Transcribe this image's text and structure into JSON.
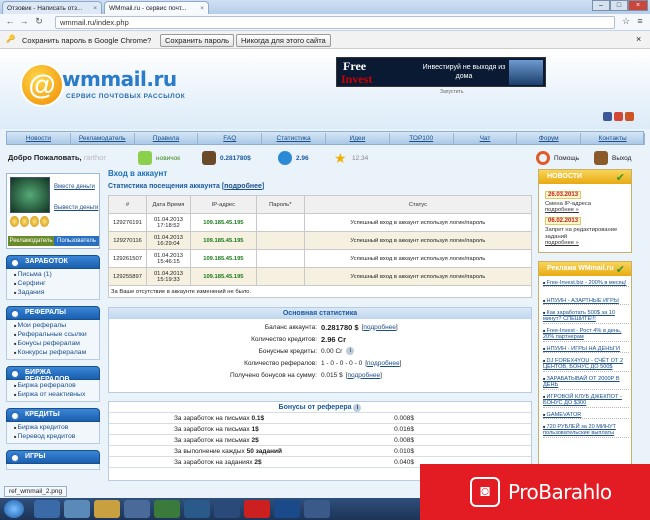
{
  "browser": {
    "tabs": [
      {
        "label": "Отзовик - Написать отз..."
      },
      {
        "label": "WMmail.ru - сервис почт..."
      }
    ],
    "url": "wmmail.ru/index.php",
    "password_bar": {
      "text": "Сохранить пароль в Google Chrome?",
      "save_label": "Сохранить пароль",
      "never_label": "Никогда для этого сайта"
    }
  },
  "site": {
    "logo_text": "wmmail.ru",
    "logo_sub": "СЕРВИС ПОЧТОВЫХ РАССЫЛОК",
    "ad": {
      "free": "Free",
      "invest": "Invest",
      "text": "Инвестируй не выходя из дома",
      "caption": "Запустить"
    },
    "menu": [
      "Новости",
      "Рекламодатель",
      "Правила",
      "FAQ",
      "Статистика",
      "Идеи",
      "ТОР100",
      "Чат",
      "Форум",
      "Контакты"
    ],
    "welcome": "Добро Пожаловать,",
    "username": "rarthor",
    "stats": {
      "level": "новичок",
      "balance": "0.281780$",
      "reserve": "2.96",
      "rating": "12.34"
    },
    "help_label": "Помощь",
    "logout_label": "Выход"
  },
  "left": {
    "earn_link": "Вместе деньги",
    "withdraw_link": "Вывести деньги",
    "role_advertiser": "Рекламодатель",
    "role_user": "Пользователь",
    "sections": [
      {
        "title": "ЗАРАБОТОК",
        "items": [
          "Письма (1)",
          "Серфинг",
          "Задания"
        ]
      },
      {
        "title": "РЕФЕРАЛЫ",
        "items": [
          "Мои рефералы",
          "Реферальные ссылки",
          "Бонусы рефералам",
          "Конкурсы рефералам"
        ]
      },
      {
        "title": "БИРЖА РЕФЕРАЛОВ",
        "items": [
          "Биржа рефералов",
          "Биржа от неактивных"
        ]
      },
      {
        "title": "КРЕДИТЫ",
        "items": [
          "Биржа кредитов",
          "Перевод кредитов"
        ]
      },
      {
        "title": "ИГРЫ",
        "items": []
      }
    ]
  },
  "main": {
    "title": "Вход в аккаунт",
    "stats_title": "Статистика посещения аккаунта",
    "more": "подробнее",
    "login_headers": [
      "#",
      "Дата Время",
      "IP-адрес",
      "Пароль*",
      "Статус"
    ],
    "login_rows": [
      {
        "id": "129276191",
        "date": "01.04.2013",
        "time": "17:18:52",
        "ip": "109.185.45.195",
        "pass": "",
        "status": "Успешный вход в аккаунт используя логин/пароль"
      },
      {
        "id": "129270116",
        "date": "01.04.2013",
        "time": "16:29:04",
        "ip": "109.185.45.195",
        "pass": "",
        "status": "Успешный вход в аккаунт используя логин/пароль"
      },
      {
        "id": "129261507",
        "date": "01.04.2013",
        "time": "15:46:15",
        "ip": "109.185.45.195",
        "pass": "",
        "status": "Успешный вход в аккаунт используя логин/пароль"
      },
      {
        "id": "129255897",
        "date": "01.04.2013",
        "time": "15:19:33",
        "ip": "109.185.45.195",
        "pass": "",
        "status": "Успешный вход в аккаунт используя логин/пароль"
      }
    ],
    "no_changes": "За Ваше отсутствие в аккаунте изменений не было.",
    "basic_title": "Основная статистика",
    "basic_rows": [
      {
        "label": "Баланс аккаунта:",
        "value": "0.281780 $",
        "link": "подробнее"
      },
      {
        "label": "Количество кредитов:",
        "value": "2.96 Cr",
        "link": ""
      },
      {
        "label": "Бонусные кредиты:",
        "value": "0.00 Cr",
        "link": ""
      },
      {
        "label": "Количество рефералов:",
        "value": "1 - 0 - 0 - 0 - 0",
        "link": "подробнее"
      },
      {
        "label": "Получено бонусов на сумму:",
        "value": "0.015 $",
        "link": "подробнее"
      }
    ],
    "bonus_title": "Бонусы от реферера",
    "bonus_rows": [
      {
        "label": "За заработок на письмах",
        "amount": "0.1$",
        "value": "0.008$"
      },
      {
        "label": "За заработок на письмах",
        "amount": "1$",
        "value": "0.016$"
      },
      {
        "label": "За заработок на письмах",
        "amount": "2$",
        "value": "0.008$"
      },
      {
        "label": "За выполнение каждых",
        "amount": "50 заданий",
        "value": "0.010$"
      },
      {
        "label": "За заработок на заданиях",
        "amount": "2$",
        "value": "0.040$"
      }
    ]
  },
  "right": {
    "news_title": "НОВОСТИ",
    "news": [
      {
        "date": "26.03.2013",
        "text": "Смена IP-адреса",
        "link": "подробнее »"
      },
      {
        "date": "06.02.2013",
        "text": "Запрет на редактирование заданий",
        "link": "подробнее »"
      }
    ],
    "ads_title": "Реклама WMmail.ru",
    "ads": [
      "Free-Invest.biz - 200% в месяц!",
      "НПУИН - АЗАРТНЫЕ ИГРЫ",
      "Как заработать 500$ за 10 минут? СПЕШИТЕ!!!",
      "Free-Invest - Рост 4% в день, 20% партнерам",
      "НПУИН - ИГРЫ НА ДЕНЬГИ",
      "DJ FOREX4YOU - СЧЁТ ОТ 2 ЦЕНТОВ, БОНУС ДО 500$",
      "ЗАРАБАТЫВАЙ ОТ 2000Р В ДЕНЬ",
      "ИГРОВОЙ КЛУБ ДЖЕКПОТ - БОНУС ДО $300",
      "GAMEVATOR",
      "720 РУБЛЕЙ за 20 МИНУТ пользовательские выплаты"
    ]
  },
  "taskbar": {
    "download_file": "ref_wmmail_2.png"
  },
  "watermark": "ProBarahlo",
  "colors": {
    "accent": "#1a6fb8",
    "ip_green": "#1a7a1a",
    "news_yellow": "#e8a911",
    "watermark_red": "#e31b23"
  }
}
